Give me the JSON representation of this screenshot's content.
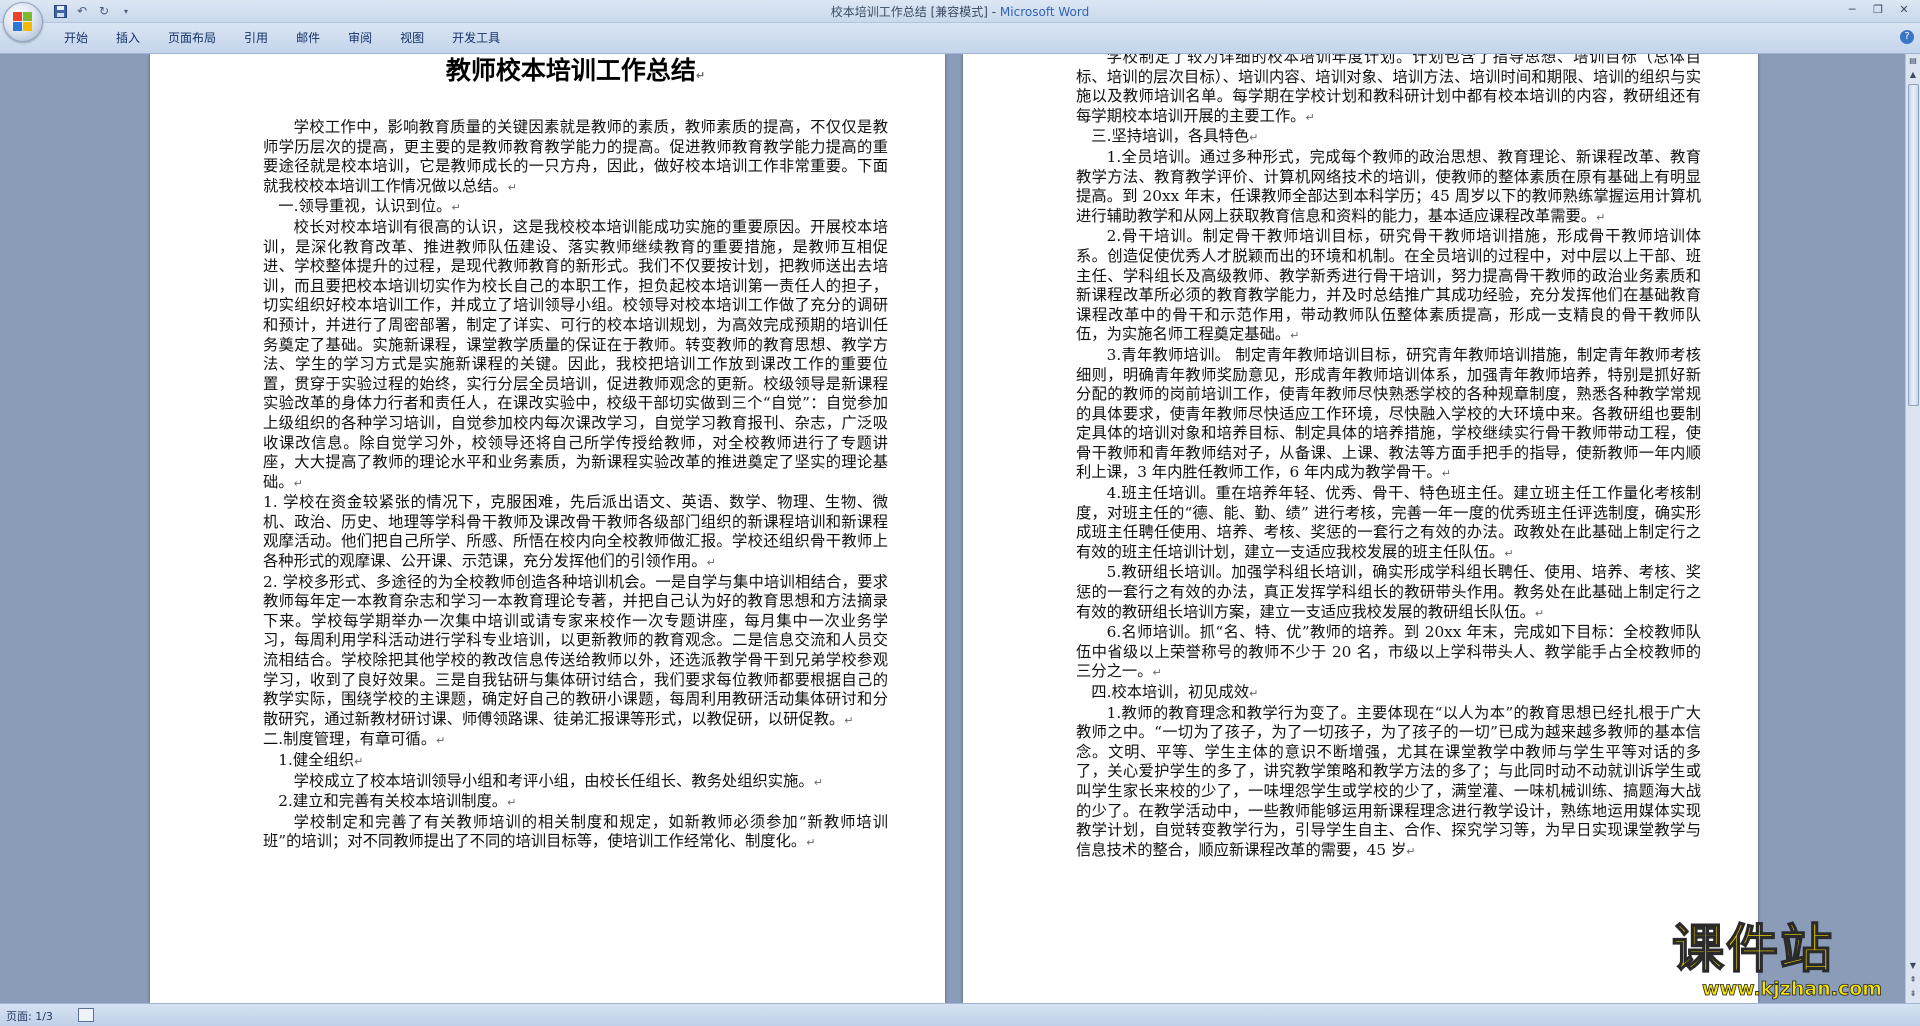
{
  "window": {
    "title_doc": "校本培训工作总结 [兼容模式] - ",
    "title_app": "Microsoft Word"
  },
  "ribbon": {
    "tabs": [
      "开始",
      "插入",
      "页面布局",
      "引用",
      "邮件",
      "审阅",
      "视图",
      "开发工具"
    ]
  },
  "status": {
    "page": "页面: 1/3"
  },
  "watermark": {
    "brand": "课件站",
    "url": "www.kjzhan.com"
  },
  "document": {
    "title": "教师校本培训工作总结",
    "page1": [
      {
        "cls": "ind",
        "text": "学校工作中，影响教育质量的关键因素就是教师的素质，教师素质的提高，不仅仅是教师学历层次的提高，更主要的是教师教育教学能力的提高。促进教师教育教学能力提高的重要途径就是校本培训，它是教师成长的一只方舟，因此，做好校本培训工作非常重要。下面就我校校本培训工作情况做以总结。"
      },
      {
        "cls": "ind1",
        "text": "一.领导重视，认识到位。"
      },
      {
        "cls": "ind",
        "text": "校长对校本培训有很高的认识，这是我校校本培训能成功实施的重要原因。开展校本培训，是深化教育改革、推进教师队伍建设、落实教师继续教育的重要措施，是教师互相促进、学校整体提升的过程，是现代教师教育的新形式。我们不仅要按计划，把教师送出去培训，而且要把校本培训切实作为校长自己的本职工作，担负起校本培训第一责任人的担子，切实组织好校本培训工作，并成立了培训领导小组。校领导对校本培训工作做了充分的调研和预计，并进行了周密部署，制定了详实、可行的校本培训规划，为高效完成预期的培训任务奠定了基础。实施新课程，课堂教学质量的保证在于教师。转变教师的教育思想、教学方法、学生的学习方式是实施新课程的关键。因此，我校把培训工作放到课改工作的重要位置，贯穿于实验过程的始终，实行分层全员培训，促进教师观念的更新。校级领导是新课程实验改革的身体力行者和责任人，在课改实验中，校级干部切实做到三个“自觉”：自觉参加上级组织的各种学习培训，自觉参加校内每次课改学习，自觉学习教育报刊、杂志，广泛吸收课改信息。除自觉学习外，校领导还将自己所学传授给教师，对全校教师进行了专题讲座，大大提高了教师的理论水平和业务素质，为新课程实验改革的推进奠定了坚实的理论基础。"
      },
      {
        "cls": "",
        "text": "1. 学校在资金较紧张的情况下，克服困难，先后派出语文、英语、数学、物理、生物、微机、政治、历史、地理等学科骨干教师及课改骨干教师各级部门组织的新课程培训和新课程观摩活动。他们把自己所学、所感、所悟在校内向全校教师做汇报。学校还组织骨干教师上各种形式的观摩课、公开课、示范课，充分发挥他们的引领作用。"
      },
      {
        "cls": "",
        "text": "2. 学校多形式、多途径的为全校教师创造各种培训机会。一是自学与集中培训相结合，要求教师每年定一本教育杂志和学习一本教育理论专著，并把自己认为好的教育思想和方法摘录下来。学校每学期举办一次集中培训或请专家来校作一次专题讲座，每月集中一次业务学习，每周利用学科活动进行学科专业培训，以更新教师的教育观念。二是信息交流和人员交流相结合。学校除把其他学校的教改信息传送给教师以外，还选派教学骨干到兄弟学校参观学习，收到了良好效果。三是自我钻研与集体研讨结合，我们要求每位教师都要根据自己的教学实际，围绕学校的主课题，确定好自己的教研小课题，每周利用教研活动集体研讨和分散研究，通过新教材研讨课、师傅领路课、徒弟汇报课等形式，以教促研，以研促教。"
      },
      {
        "cls": "",
        "text": "二.制度管理，有章可循。"
      },
      {
        "cls": "ind1",
        "text": "1.健全组织"
      },
      {
        "cls": "ind",
        "text": "学校成立了校本培训领导小组和考评小组，由校长任组长、教务处组织实施。"
      },
      {
        "cls": "ind1",
        "text": "2.建立和完善有关校本培训制度。"
      },
      {
        "cls": "ind",
        "text": "学校制定和完善了有关教师培训的相关制度和规定，如新教师必须参加“新教师培训班”的培训；对不同教师提出了不同的培训目标等，使培训工作经常化、制度化。"
      }
    ],
    "page2": [
      {
        "cls": "ind",
        "text": "学校制定了较为详细的校本培训年度计划。计划包含了指导思想、培训目标（总体目标、培训的层次目标）、培训内容、培训对象、培训方法、培训时间和期限、培训的组织与实施以及教师培训名单。每学期在学校计划和教科研计划中都有校本培训的内容，教研组还有每学期校本培训开展的主要工作。"
      },
      {
        "cls": "ind1",
        "text": "三.坚持培训，各具特色"
      },
      {
        "cls": "ind",
        "text": "1.全员培训。通过多种形式，完成每个教师的政治思想、教育理论、新课程改革、教育教学方法、教育教学评价、计算机网络技术的培训，使教师的整体素质在原有基础上有明显提高。到 20xx 年末，任课教师全部达到本科学历；45 周岁以下的教师熟练掌握运用计算机进行辅助教学和从网上获取教育信息和资料的能力，基本适应课程改革需要。"
      },
      {
        "cls": "ind",
        "text": "2.骨干培训。制定骨干教师培训目标，研究骨干教师培训措施，形成骨干教师培训体系。创造促使优秀人才脱颖而出的环境和机制。在全员培训的过程中，对中层以上干部、班主任、学科组长及高级教师、教学新秀进行骨干培训，努力提高骨干教师的政治业务素质和新课程改革所必须的教育教学能力，并及时总结推广其成功经验，充分发挥他们在基础教育课程改革中的骨干和示范作用，带动教师队伍整体素质提高，形成一支精良的骨干教师队伍，为实施名师工程奠定基础。"
      },
      {
        "cls": "ind",
        "text": "3.青年教师培训。 制定青年教师培训目标，研究青年教师培训措施，制定青年教师考核细则，明确青年教师奖励意见，形成青年教师培训体系，加强青年教师培养，特别是抓好新分配的教师的岗前培训工作，使青年教师尽快熟悉学校的各种规章制度，熟悉各种教学常规的具体要求，使青年教师尽快适应工作环境，尽快融入学校的大环境中来。各教研组也要制定具体的培训对象和培养目标、制定具体的培养措施，学校继续实行骨干教师带动工程，使骨干教师和青年教师结对子，从备课、上课、教法等方面手把手的指导，使新教师一年内顺利上课，3 年内胜任教师工作，6 年内成为教学骨干。"
      },
      {
        "cls": "ind",
        "text": "4.班主任培训。重在培养年轻、优秀、骨干、特色班主任。建立班主任工作量化考核制度，对班主任的“德、能、勤、绩” 进行考核，完善一年一度的优秀班主任评选制度，确实形成班主任聘任使用、培养、考核、奖惩的一套行之有效的办法。政教处在此基础上制定行之有效的班主任培训计划，建立一支适应我校发展的班主任队伍。"
      },
      {
        "cls": "ind",
        "text": "5.教研组长培训。加强学科组长培训，确实形成学科组长聘任、使用、培养、考核、奖惩的一套行之有效的办法，真正发挥学科组长的教研带头作用。教务处在此基础上制定行之有效的教研组长培训方案，建立一支适应我校发展的教研组长队伍。"
      },
      {
        "cls": "ind",
        "text": "6.名师培训。抓“名、特、优”教师的培养。到 20xx 年末，完成如下目标：全校教师队伍中省级以上荣誉称号的教师不少于 20 名，市级以上学科带头人、教学能手占全校教师的三分之一。"
      },
      {
        "cls": "ind1",
        "text": "四.校本培训，初见成效"
      },
      {
        "cls": "ind",
        "text": "1.教师的教育理念和教学行为变了。主要体现在“以人为本”的教育思想已经扎根于广大教师之中。“一切为了孩子，为了一切孩子，为了孩子的一切”已成为越来越多教师的基本信念。文明、平等、学生主体的意识不断增强，尤其在课堂教学中教师与学生平等对话的多了，关心爱护学生的多了，讲究教学策略和教学方法的多了；与此同时动不动就训诉学生或叫学生家长来校的少了，一味埋怨学生或学校的少了，满堂灌、一味机械训练、搞题海大战的少了。在教学活动中，一些教师能够运用新课程理念进行教学设计，熟练地运用媒体实现教学计划，自觉转变教学行为，引导学生自主、合作、探究学习等，为早日实现课堂教学与信息技术的整合，顺应新课程改革的需要，45 岁"
      }
    ]
  }
}
